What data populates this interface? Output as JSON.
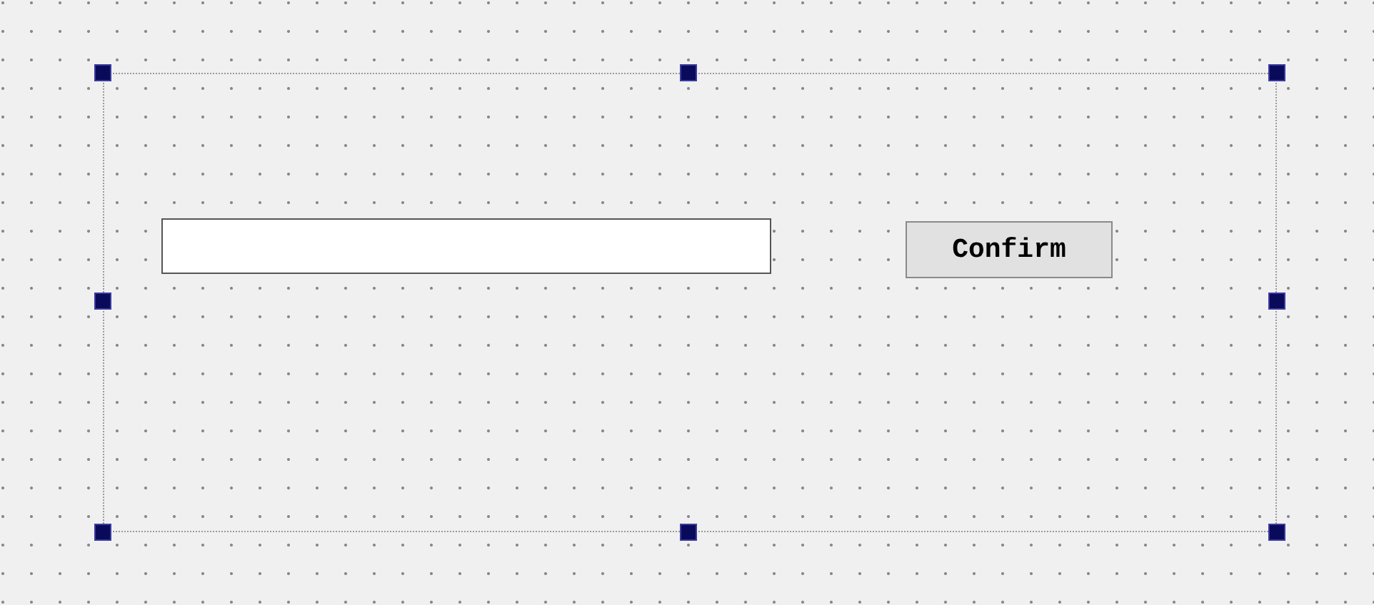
{
  "form": {
    "selected": true,
    "widgets": [
      {
        "kind": "line-edit"
      },
      {
        "kind": "push-button",
        "label": "Confirm"
      }
    ]
  }
}
